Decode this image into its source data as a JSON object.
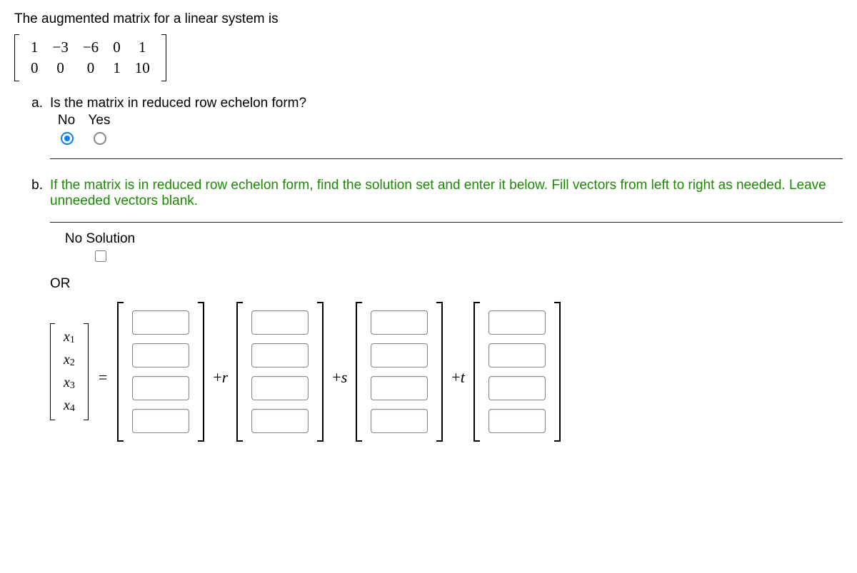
{
  "intro": "The augmented matrix for a linear system is",
  "matrix": {
    "rows": [
      [
        "1",
        "−3",
        "−6",
        "0",
        "1"
      ],
      [
        "0",
        "0",
        "0",
        "1",
        "10"
      ]
    ]
  },
  "parts": {
    "a": {
      "marker": "a.",
      "question": "Is the matrix in reduced row echelon form?",
      "options": {
        "no": "No",
        "yes": "Yes"
      },
      "selected": "no"
    },
    "b": {
      "marker": "b.",
      "prompt": "If the matrix is in reduced row echelon form, find the solution set and enter it below. Fill vectors from left to right as needed. Leave unneeded vectors blank.",
      "no_solution_label": "No Solution",
      "or_label": "OR",
      "xvars": [
        "x1",
        "x2",
        "x3",
        "x4"
      ],
      "equals": "=",
      "params": [
        "+r",
        "+s",
        "+t"
      ]
    }
  }
}
